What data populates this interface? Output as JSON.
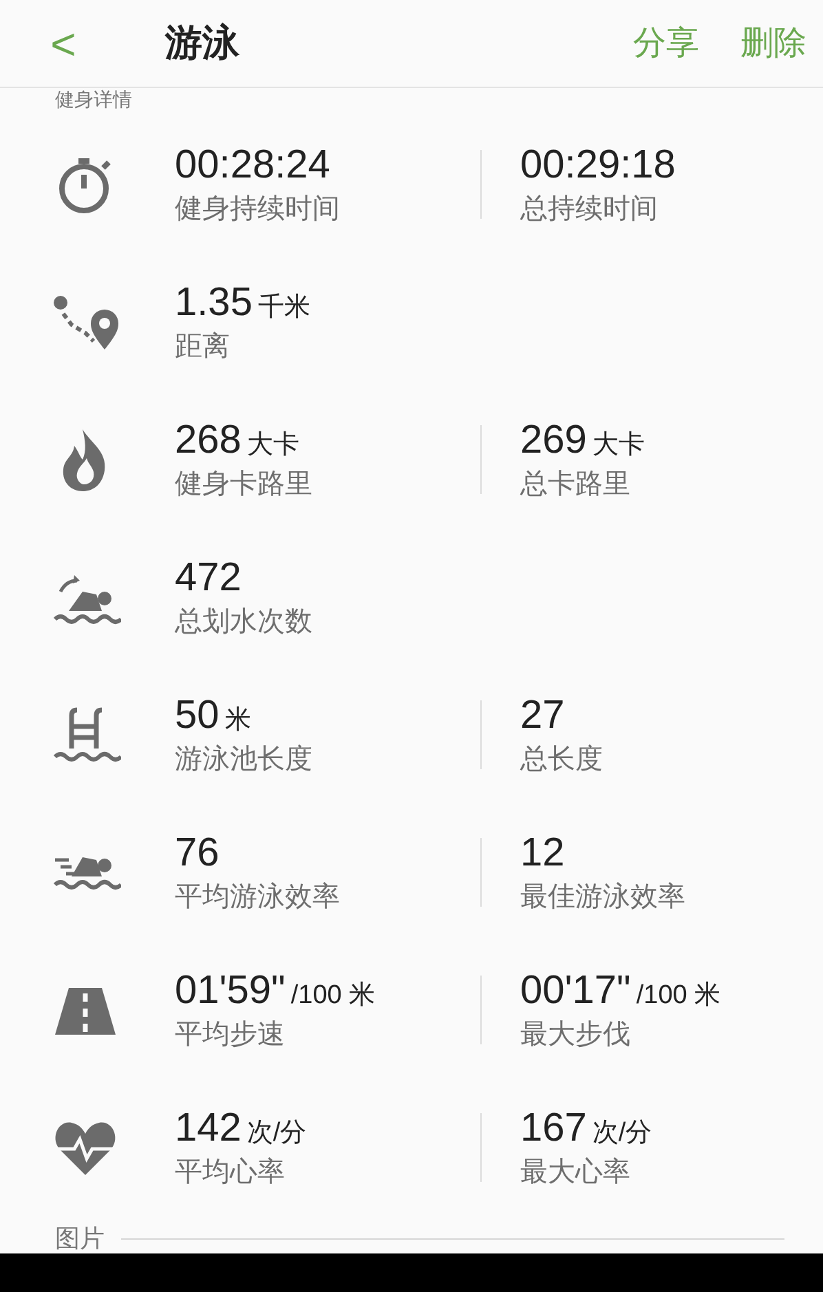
{
  "header": {
    "back": "<",
    "title": "游泳",
    "actions": [
      "分享",
      "删除"
    ]
  },
  "section_title": "健身详情",
  "rows": [
    {
      "items": [
        {
          "value": "00:28:24",
          "label": "健身持续时间"
        },
        {
          "value": "00:29:18",
          "label": "总持续时间"
        }
      ]
    },
    {
      "items": [
        {
          "value": "1.35",
          "unit": "千米",
          "label": "距离"
        }
      ]
    },
    {
      "items": [
        {
          "value": "268",
          "unit": "大卡",
          "label": "健身卡路里"
        },
        {
          "value": "269",
          "unit": "大卡",
          "label": "总卡路里"
        }
      ]
    },
    {
      "items": [
        {
          "value": "472",
          "label": "总划水次数"
        }
      ]
    },
    {
      "items": [
        {
          "value": "50",
          "unit": "米",
          "label": "游泳池长度"
        },
        {
          "value": "27",
          "label": "总长度"
        }
      ]
    },
    {
      "items": [
        {
          "value": "76",
          "label": "平均游泳效率"
        },
        {
          "value": "12",
          "label": "最佳游泳效率"
        }
      ]
    },
    {
      "items": [
        {
          "value": "01'59\"",
          "unit": "/100 米",
          "label": "平均步速"
        },
        {
          "value": "00'17\"",
          "unit": "/100 米",
          "label": "最大步伐"
        }
      ]
    },
    {
      "items": [
        {
          "value": "142",
          "unit": "次/分",
          "label": "平均心率"
        },
        {
          "value": "167",
          "unit": "次/分",
          "label": "最大心率"
        }
      ]
    }
  ],
  "footer_section": "图片"
}
